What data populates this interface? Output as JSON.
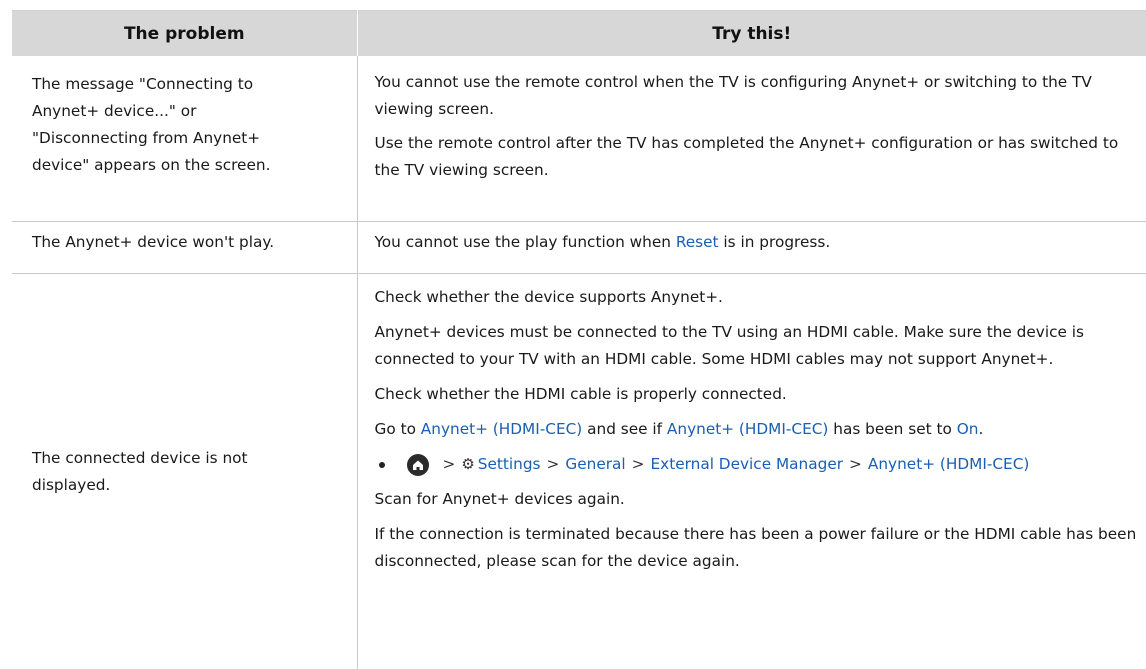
{
  "header": {
    "col1": "The problem",
    "col2": "Try this!"
  },
  "rows": [
    {
      "problem": "The message \"Connecting to Anynet+ device...\" or \"Disconnecting from Anynet+ device\" appears on the screen.",
      "solutions": [
        "You cannot use the remote control when the TV is configuring Anynet+ or switching to the TV viewing screen.",
        "Use the remote control after the TV has completed the Anynet+ configuration or has switched to the TV viewing screen."
      ]
    },
    {
      "problem": "The Anynet+ device won't play.",
      "solution_pre": "You cannot use the play function when ",
      "solution_link": "Reset",
      "solution_post": " is in progress."
    },
    {
      "problem": "The connected device is not displayed.",
      "s1": "Check whether the device supports Anynet+.",
      "s2": "Anynet+ devices must be connected to the TV using an HDMI cable. Make sure the device is connected to your TV with an HDMI cable. Some HDMI cables may not support Anynet+.",
      "s3": "Check whether the HDMI cable is properly connected.",
      "s4_a": "Go to ",
      "s4_link1": "Anynet+ (HDMI-CEC)",
      "s4_b": " and see if ",
      "s4_link2": "Anynet+ (HDMI-CEC)",
      "s4_c": " has been set to ",
      "s4_link3": "On",
      "s4_d": ".",
      "path": {
        "sep": ">",
        "settings": "Settings",
        "general": "General",
        "manager": "External Device Manager",
        "anynet": "Anynet+ (HDMI-CEC)"
      },
      "s5": "Scan for Anynet+ devices again.",
      "s6": "If the connection is terminated because there has been a power failure or the HDMI cable has been disconnected, please scan for the device again."
    }
  ],
  "colors": {
    "link": "#1a5fb4",
    "header_bg": "#d7d7d7"
  },
  "icons": [
    "home-icon",
    "gear-icon"
  ]
}
